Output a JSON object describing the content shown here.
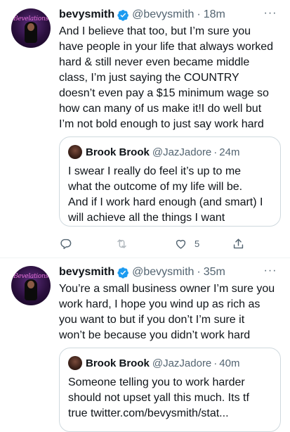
{
  "tweets": [
    {
      "author": {
        "name": "bevysmith",
        "handle": "@bevysmith",
        "time": "18m",
        "avatar_text": "Bevelations",
        "verified": true
      },
      "text_lines": [
        "And I believe that too, but I’m sure you",
        "have people in your life that always worked",
        "hard & still never even became middle",
        "class, I’m just saying the COUNTRY",
        "doesn’t even pay a $15 minimum wage so",
        "how can many of us make it!I do well but",
        "I’m not bold enough to just say work hard"
      ],
      "quote": {
        "name": "Brook Brook",
        "handle": "@JazJadore",
        "time": "24m",
        "text_lines": [
          "I swear I really do feel it’s up to me",
          "what the outcome of my life will be.",
          "And if I work hard enough (and smart) I",
          "will achieve all the things I want"
        ]
      },
      "actions": {
        "reply": "",
        "retweet": "",
        "like_count": "5",
        "share": ""
      }
    },
    {
      "author": {
        "name": "bevysmith",
        "handle": "@bevysmith",
        "time": "35m",
        "avatar_text": "Bevelations",
        "verified": true
      },
      "text_lines": [
        "You’re a small business owner I’m sure you",
        "work hard, I hope you wind up as rich as",
        "you want to but if you don’t I’m sure it",
        "won’t be because you didn’t work hard"
      ],
      "quote": {
        "name": "Brook Brook",
        "handle": "@JazJadore",
        "time": "40m",
        "text_lines": [
          "Someone telling you to work harder",
          "should not upset yall this much. Its tf",
          "true twitter.com/bevysmith/stat..."
        ]
      }
    }
  ],
  "colors": {
    "verified": "#1d9bf0",
    "muted_text": "#536471",
    "border": "#cfd9de",
    "text": "#0f1419"
  },
  "icons": [
    "verified-badge-icon",
    "more-icon",
    "reply-icon",
    "retweet-icon",
    "like-icon",
    "share-icon"
  ]
}
